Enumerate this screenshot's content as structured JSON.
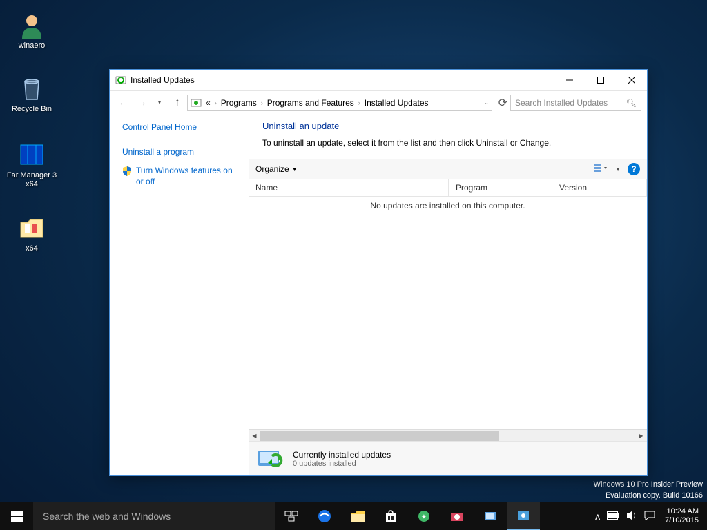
{
  "desktop": {
    "icons": {
      "winaero": "winaero",
      "recyclebin": "Recycle Bin",
      "farmanager": "Far Manager 3 x64",
      "x64": "x64"
    },
    "watermark": {
      "line1": "Windows 10 Pro Insider Preview",
      "line2": "Evaluation copy. Build 10166"
    }
  },
  "window": {
    "title": "Installed Updates",
    "breadcrumb": {
      "overflow": "«",
      "items": [
        "Programs",
        "Programs and Features",
        "Installed Updates"
      ]
    },
    "search_placeholder": "Search Installed Updates",
    "sidebar": {
      "home": "Control Panel Home",
      "uninstall": "Uninstall a program",
      "features": "Turn Windows features on or off"
    },
    "content": {
      "heading": "Uninstall an update",
      "description": "To uninstall an update, select it from the list and then click Uninstall or Change.",
      "toolbar": {
        "organize": "Organize"
      },
      "columns": {
        "name": "Name",
        "program": "Program",
        "version": "Version"
      },
      "empty": "No updates are installed on this computer."
    },
    "status": {
      "line1": "Currently installed updates",
      "line2": "0 updates installed"
    }
  },
  "taskbar": {
    "search_placeholder": "Search the web and Windows",
    "clock": {
      "time": "10:24 AM",
      "date": "7/10/2015"
    }
  }
}
